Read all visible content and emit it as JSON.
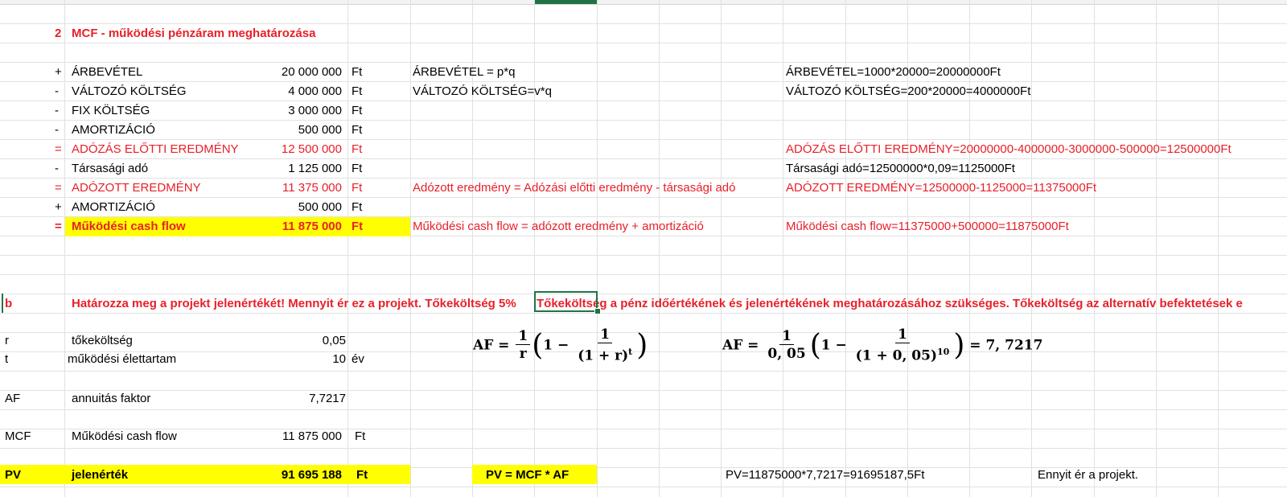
{
  "section_num": "2",
  "section_title": "MCF - működési pénzáram meghatározása",
  "rows": [
    {
      "sign": "+",
      "label": "ÁRBEVÉTEL",
      "value": "20 000 000",
      "unit": "Ft",
      "formula": "ÁRBEVÉTEL = p*q",
      "calc": "ÁRBEVÉTEL=1000*20000=20000000Ft"
    },
    {
      "sign": "-",
      "label": "VÁLTOZÓ KÖLTSÉG",
      "value": "4 000 000",
      "unit": "Ft",
      "formula": " VÁLTOZÓ KÖLTSÉG=v*q",
      "calc": "VÁLTOZÓ KÖLTSÉG=200*20000=4000000Ft"
    },
    {
      "sign": "-",
      "label": "FIX KÖLTSÉG",
      "value": "3 000 000",
      "unit": " Ft",
      "formula": "",
      "calc": ""
    },
    {
      "sign": "-",
      "label": "AMORTIZÁCIÓ",
      "value": "500 000",
      "unit": "Ft",
      "formula": "",
      "calc": ""
    },
    {
      "sign": "=",
      "label": "ADÓZÁS ELŐTTI EREDMÉNY",
      "value": "12 500 000",
      "unit": "Ft",
      "formula": "",
      "calc": "ADÓZÁS ELŐTTI EREDMÉNY=20000000-4000000-3000000-500000=12500000Ft"
    },
    {
      "sign": "-",
      "label": "Társasági adó",
      "value": "1 125 000",
      "unit": "Ft",
      "formula": "",
      "calc": "Társasági adó=12500000*0,09=1125000Ft"
    },
    {
      "sign": "=",
      "label": "ADÓZOTT EREDMÉNY",
      "value": "11 375 000",
      "unit": "Ft",
      "formula": "Adózott eredmény = Adózási előtti eredmény - társasági adó",
      "calc": "ADÓZOTT EREDMÉNY=12500000-1125000=11375000Ft"
    },
    {
      "sign": "+",
      "label": "AMORTIZÁCIÓ",
      "value": "500 000",
      "unit": " Ft",
      "formula": "",
      "calc": ""
    },
    {
      "sign": "=",
      "label": "Működési cash flow",
      "value": "11 875 000",
      "unit": "Ft",
      "formula": " Működési cash flow = adózott eredmény + amortizáció",
      "calc": "Működési cash flow=11375000+500000=11875000Ft"
    }
  ],
  "b_label": "b",
  "b_text": "Határozza meg a projekt jelenértékét! Mennyit ér ez a projekt. Tőkeköltség 5%",
  "b_text2": "Tőkeköltség a pénz időértékének és jelenértékének meghatározásához szükséges. Tőkeköltség az alternatív befektetések e",
  "params": [
    {
      "sym": "r",
      "label": "tőkeköltség",
      "value": "0,05",
      "unit": ""
    },
    {
      "sym": "t",
      "label": "működési élettartam",
      "value": "10",
      "unit": "év"
    },
    {
      "sym": "AF",
      "label": "annuitás faktor",
      "value": "7,7217",
      "unit": ""
    },
    {
      "sym": "MCF",
      "label": "Működési cash flow",
      "value": "11 875 000",
      "unit": "Ft"
    }
  ],
  "pv": {
    "sym": "PV",
    "label": "jelenérték",
    "value": "91 695 188",
    "unit": "Ft",
    "formula": "PV = MCF * AF",
    "calc": "PV=11875000*7,7217=91695187,5Ft",
    "note": "Ennyit ér a projekt."
  },
  "af_formula": {
    "lhs": "AF",
    "one": "1",
    "r": "r",
    "open": "(",
    "close": ")",
    "den": "(1 + r)",
    "exp": "t"
  },
  "af_calc": {
    "lhs": "AF",
    "one": "1",
    "r": "0, 05",
    "den": "(1 + 0, 05)",
    "exp": "10",
    "result": "= 7, 7217"
  },
  "colors": {
    "red": "#e8202a",
    "highlight": "#ffff00",
    "selection": "#217346"
  }
}
